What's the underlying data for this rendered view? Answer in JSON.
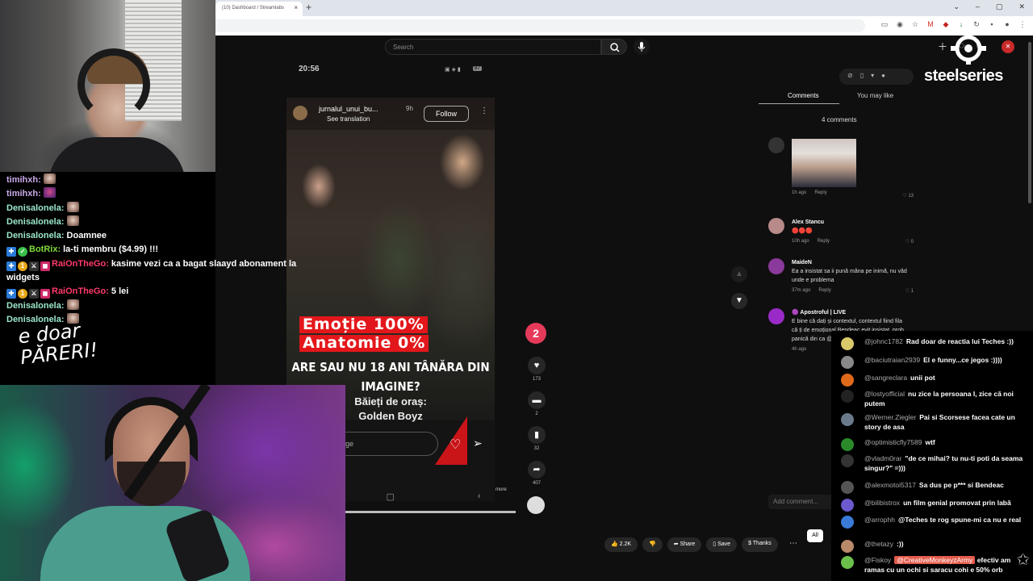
{
  "browser": {
    "tab_title": "(10) Dashboard / Streamlabs",
    "tab_close": "×",
    "new_tab": "+",
    "window_controls": [
      "⌄",
      "–",
      "▢",
      "✕"
    ]
  },
  "youtube": {
    "search_placeholder": "Search",
    "search_icon": "search-icon",
    "mic_icon": "mic-icon",
    "avatar_initial": "✕"
  },
  "phone": {
    "time": "20:56",
    "status_icons": "▪ ◆ ☁ •",
    "right_icons": "▣ ◈ ▮",
    "battery": "87"
  },
  "video": {
    "username": "jurnalul_unui_bu...",
    "time_ago": "9h",
    "see_translation": "See translation",
    "follow_label": "Follow",
    "line1": "Emoție 100%",
    "line2": "Anatomie 0%",
    "question_line1": "ARE SAU NU 18 ANI TÂNĂRA DIN",
    "question_line2": "IMAGINE?",
    "sub_line1": "Băieți de oraș:",
    "sub_line2": "Golden Boyz",
    "reply_placeholder": "ge",
    "more": "more"
  },
  "rail": {
    "badge": "2",
    "like_count": "173",
    "comment_count": "2",
    "save_count": "32",
    "share_count": "407"
  },
  "comments": {
    "tab_comments": "Comments",
    "tab_you_may_like": "You may like",
    "count": "4 comments",
    "items": [
      {
        "time": "1h ago",
        "reply": "Reply",
        "likes": "13"
      },
      {
        "name": "Alex Stancu",
        "text": "🔴🔴🔴",
        "time": "10h ago",
        "reply": "Reply",
        "likes": "0"
      },
      {
        "name": "MaideN",
        "text": "Ea a insistat sa ii pună mâna pe inimă, nu văd unde e problema",
        "time": "37m ago",
        "reply": "Reply",
        "likes": "1"
      },
      {
        "name": "🟣 Apostroful | LIVE",
        "text": "E bine că dați și contextul, contextul fiind fila că ți de emoțional Bendeac evit insistat, prob panică din ca @Mihai Bend",
        "time": "4h ago"
      }
    ],
    "add_comment": "Add comment..."
  },
  "bottom_bar": {
    "likes": "2.2K",
    "share": "Share",
    "save": "Save",
    "thanks": "Thanks",
    "all": "All"
  },
  "twitch_chat": [
    {
      "user": "timihxh:",
      "color": "#c8a8e8",
      "msg": "",
      "emote": 1
    },
    {
      "user": "timihxh:",
      "color": "#c8a8e8",
      "msg": "",
      "emote": 2
    },
    {
      "user": "Denisalonela:",
      "color": "#9ae6c8",
      "msg": "",
      "emote": 1
    },
    {
      "user": "Denisalonela:",
      "color": "#9ae6c8",
      "msg": "",
      "emote": 1
    },
    {
      "user": "Denisalonela:",
      "color": "#9ae6c8",
      "msg": "Doamnee",
      "emote": 0
    },
    {
      "user": "BotRix:",
      "color": "#7ddc3a",
      "msg": "la-ti membru ($4.99) !!!",
      "emote": 0
    },
    {
      "user": "RaiOnTheGo:",
      "color": "#ff3a6a",
      "msg": "kasime vezi ca a bagat slaayd abonament la",
      "emote": 0
    },
    {
      "user": "",
      "color": "#fff",
      "msg": "widgets",
      "emote": 0
    },
    {
      "user": "RaiOnTheGo:",
      "color": "#ff3a6a",
      "msg": "5 lei",
      "emote": 0
    },
    {
      "user": "Denisalonela:",
      "color": "#9ae6c8",
      "msg": "",
      "emote": 1
    },
    {
      "user": "Denisalonela:",
      "color": "#9ae6c8",
      "msg": "",
      "emote": 1
    }
  ],
  "handwriting": "e doar PĂRERI!",
  "steelseries": "steelseries",
  "live_chat": [
    {
      "name": "@johnc1782",
      "text": "Rad doar de reactia lui Teches :))",
      "av": "#d9c86a"
    },
    {
      "name": "@baciutraian2939",
      "text": "El e funny...ce jegos :))))",
      "av": "#888"
    },
    {
      "name": "@sangreclara",
      "text": "unii pot",
      "av": "#e06a1a"
    },
    {
      "name": "@lostyofficial",
      "text": "nu zice la persoana I, zice că noi putem",
      "av": "#222"
    },
    {
      "name": "@Werner.Ziegler",
      "text": "Pai si Scorsese facea cate un story de asa",
      "av": "#6a7a8a"
    },
    {
      "name": "@optimisticfly7589",
      "text": "wtf",
      "av": "#2a8a2a"
    },
    {
      "name": "@vladm0rar",
      "text": "\"de ce mihai? tu nu-ti poti da seama singur?\" =)))",
      "av": "#333"
    },
    {
      "name": "@alexmotoi5317",
      "text": "Sa dus pe p*** si Bendeac",
      "av": "#555"
    },
    {
      "name": "@bilibistrox",
      "text": "un film genial promovat prin labă",
      "av": "#6a5acd"
    },
    {
      "name": "@arrophh",
      "text": "@Teches te rog spune-mi ca nu e real",
      "av": "#3a7ad8"
    },
    {
      "name": "@thetazy",
      "text": ":))",
      "av": "#b88a6a"
    },
    {
      "name": "@Fiskoy",
      "text": "efectiv am ramas cu un ochi si saracu cohi e 50% orb",
      "tag": "@CreativeMonkeyzArmy",
      "av": "#6ac04a"
    }
  ]
}
